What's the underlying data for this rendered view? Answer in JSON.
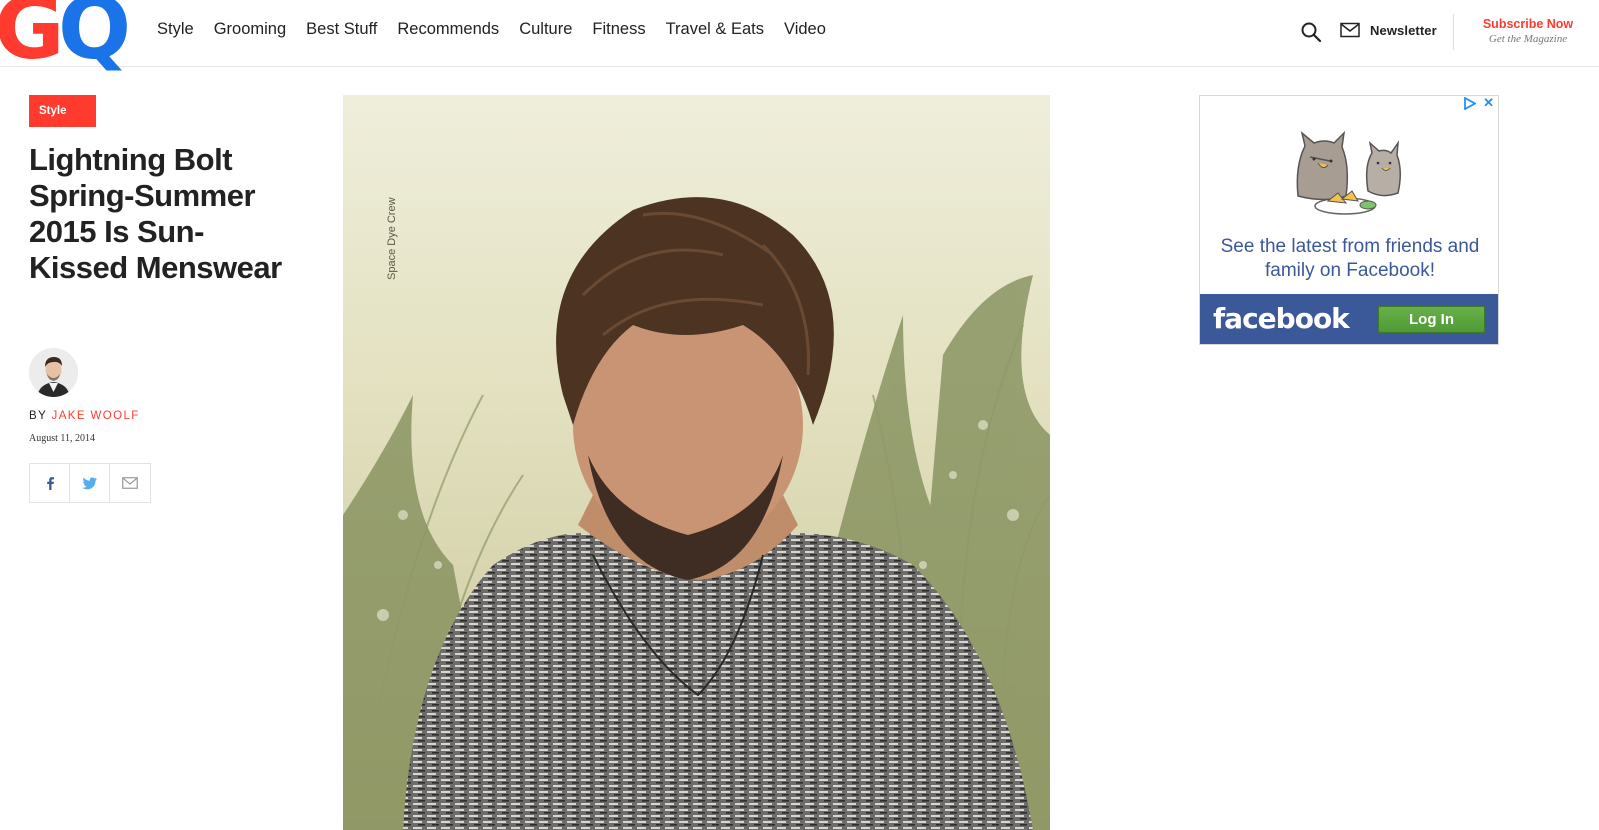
{
  "header": {
    "logo_text": "GQ",
    "nav": [
      {
        "label": "Style"
      },
      {
        "label": "Grooming"
      },
      {
        "label": "Best Stuff"
      },
      {
        "label": "Recommends"
      },
      {
        "label": "Culture"
      },
      {
        "label": "Fitness"
      },
      {
        "label": "Travel & Eats"
      },
      {
        "label": "Video"
      }
    ],
    "search_icon": "search-icon",
    "newsletter_label": "Newsletter",
    "subscribe_label": "Subscribe Now",
    "subscribe_sub": "Get the Magazine"
  },
  "article": {
    "category": "Style",
    "headline": "Lightning Bolt Spring-Summer 2015 Is Sun-Kissed Menswear",
    "byline_prefix": "BY",
    "author": "JAKE WOOLF",
    "date": "August 11, 2014",
    "share": [
      "facebook-icon",
      "twitter-icon",
      "email-icon"
    ],
    "image_watermark": "Space Dye Crew"
  },
  "ad": {
    "text": "See the latest from friends and family on Facebook!",
    "brand": "facebook",
    "cta": "Log In",
    "close": "✕"
  },
  "colors": {
    "accent": "#ff3b30",
    "logo_blue": "#1a73e8",
    "facebook_blue": "#3b5998",
    "login_green": "#5ca43f"
  }
}
